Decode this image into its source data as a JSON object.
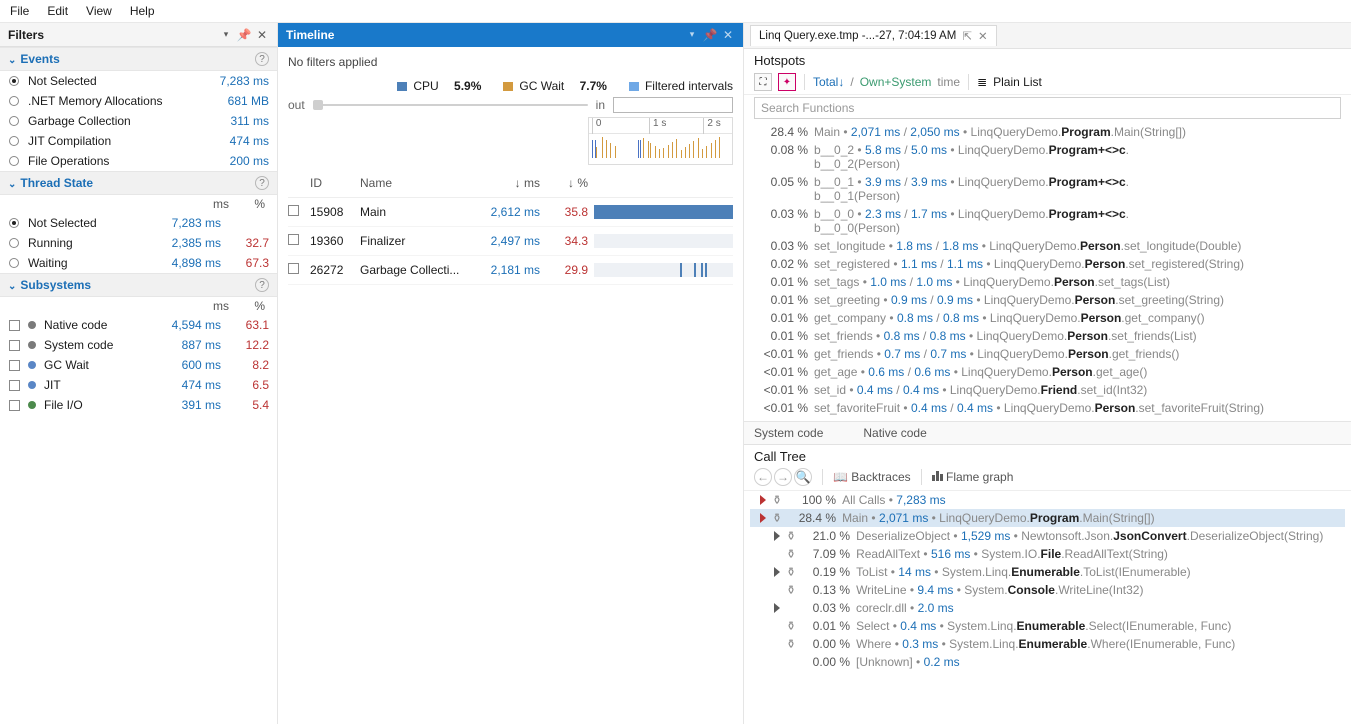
{
  "menu": {
    "file": "File",
    "edit": "Edit",
    "view": "View",
    "help": "Help"
  },
  "filters": {
    "title": "Filters",
    "events": {
      "title": "Events",
      "rows": [
        {
          "name": "Not Selected",
          "ms": "7,283 ms",
          "selected": true,
          "kind": "radio"
        },
        {
          "name": ".NET Memory Allocations",
          "ms": "681 MB",
          "selected": false,
          "kind": "radio"
        },
        {
          "name": "Garbage Collection",
          "ms": "311 ms",
          "selected": false,
          "kind": "radio"
        },
        {
          "name": "JIT Compilation",
          "ms": "474 ms",
          "selected": false,
          "kind": "radio"
        },
        {
          "name": "File Operations",
          "ms": "200 ms",
          "selected": false,
          "kind": "radio"
        }
      ]
    },
    "thread": {
      "title": "Thread State",
      "header": {
        "ms": "ms",
        "pct": "%"
      },
      "rows": [
        {
          "name": "Not Selected",
          "ms": "7,283 ms",
          "pct": "",
          "selected": true,
          "kind": "radio"
        },
        {
          "name": "Running",
          "ms": "2,385 ms",
          "pct": "32.7",
          "selected": false,
          "kind": "radio"
        },
        {
          "name": "Waiting",
          "ms": "4,898 ms",
          "pct": "67.3",
          "selected": false,
          "kind": "radio"
        }
      ]
    },
    "subsystems": {
      "title": "Subsystems",
      "header": {
        "ms": "ms",
        "pct": "%"
      },
      "rows": [
        {
          "name": "Native code",
          "ms": "4,594 ms",
          "pct": "63.1",
          "color": "#7a7a7a"
        },
        {
          "name": "System code",
          "ms": "887 ms",
          "pct": "12.2",
          "color": "#7a7a7a"
        },
        {
          "name": "GC Wait",
          "ms": "600 ms",
          "pct": "8.2",
          "color": "#5a86c5"
        },
        {
          "name": "JIT",
          "ms": "474 ms",
          "pct": "6.5",
          "color": "#5a86c5"
        },
        {
          "name": "File I/O",
          "ms": "391 ms",
          "pct": "5.4",
          "color": "#4c8a4c"
        }
      ]
    }
  },
  "timeline": {
    "title": "Timeline",
    "nofilters": "No filters applied",
    "legend": {
      "cpu": "CPU",
      "cpu_pct": "5.9%",
      "gc": "GC Wait",
      "gc_pct": "7.7%",
      "filtered": "Filtered intervals"
    },
    "zoom": {
      "out": "out",
      "in": "in"
    },
    "ruler": [
      "0",
      "1 s",
      "2 s"
    ],
    "columns": {
      "id": "ID",
      "name": "Name",
      "ms": "↓ ms",
      "pct": "↓ %"
    },
    "rows": [
      {
        "id": "15908",
        "name": "Main",
        "ms": "2,612 ms",
        "pct": "35.8",
        "main": true
      },
      {
        "id": "19360",
        "name": "Finalizer",
        "ms": "2,497 ms",
        "pct": "34.3"
      },
      {
        "id": "26272",
        "name": "Garbage Collecti...",
        "ms": "2,181 ms",
        "pct": "29.9",
        "marks": [
          62,
          72,
          77,
          80
        ]
      }
    ]
  },
  "tab": {
    "label": "Linq Query.exe.tmp -...-27, 7:04:19 AM"
  },
  "hotspots": {
    "title": "Hotspots",
    "toolbar": {
      "total": "Total↓",
      "sep": "/",
      "own": "Own+System",
      "time": "time",
      "plain": "Plain List"
    },
    "search_placeholder": "Search Functions",
    "rows": [
      {
        "pct": "28.4 %",
        "short": "Main",
        "t1": "2,071 ms",
        "t2": "2,050 ms",
        "pre": "LinqQueryDemo.",
        "strong": "Program",
        "post": ".Main(String[])"
      },
      {
        "pct": "0.08 %",
        "short": "<Main>b__0_2",
        "t1": "5.8 ms",
        "t2": "5.0 ms",
        "pre": "LinqQueryDemo.",
        "strong": "Program+<>c",
        "post": ".<Main>b__0_2(Person)"
      },
      {
        "pct": "0.05 %",
        "short": "<Main>b__0_1",
        "t1": "3.9 ms",
        "t2": "3.9 ms",
        "pre": "LinqQueryDemo.",
        "strong": "Program+<>c",
        "post": ".<Main>b__0_1(Person)"
      },
      {
        "pct": "0.03 %",
        "short": "<Main>b__0_0",
        "t1": "2.3 ms",
        "t2": "1.7 ms",
        "pre": "LinqQueryDemo.",
        "strong": "Program+<>c",
        "post": ".<Main>b__0_0(Person)"
      },
      {
        "pct": "0.03 %",
        "short": "set_longitude",
        "t1": "1.8 ms",
        "t2": "1.8 ms",
        "pre": "LinqQueryDemo.",
        "strong": "Person",
        "post": ".set_longitude(Double)"
      },
      {
        "pct": "0.02 %",
        "short": "set_registered",
        "t1": "1.1 ms",
        "t2": "1.1 ms",
        "pre": "LinqQueryDemo.",
        "strong": "Person",
        "post": ".set_registered(String)"
      },
      {
        "pct": "0.01 %",
        "short": "set_tags",
        "t1": "1.0 ms",
        "t2": "1.0 ms",
        "pre": "LinqQueryDemo.",
        "strong": "Person",
        "post": ".set_tags(List)"
      },
      {
        "pct": "0.01 %",
        "short": "set_greeting",
        "t1": "0.9 ms",
        "t2": "0.9 ms",
        "pre": "LinqQueryDemo.",
        "strong": "Person",
        "post": ".set_greeting(String)"
      },
      {
        "pct": "0.01 %",
        "short": "get_company",
        "t1": "0.8 ms",
        "t2": "0.8 ms",
        "pre": "LinqQueryDemo.",
        "strong": "Person",
        "post": ".get_company()"
      },
      {
        "pct": "0.01 %",
        "short": "set_friends",
        "t1": "0.8 ms",
        "t2": "0.8 ms",
        "pre": "LinqQueryDemo.",
        "strong": "Person",
        "post": ".set_friends(List)"
      },
      {
        "pct": "<0.01 %",
        "short": "get_friends",
        "t1": "0.7 ms",
        "t2": "0.7 ms",
        "pre": "LinqQueryDemo.",
        "strong": "Person",
        "post": ".get_friends()"
      },
      {
        "pct": "<0.01 %",
        "short": "get_age",
        "t1": "0.6 ms",
        "t2": "0.6 ms",
        "pre": "LinqQueryDemo.",
        "strong": "Person",
        "post": ".get_age()"
      },
      {
        "pct": "<0.01 %",
        "short": "set_id",
        "t1": "0.4 ms",
        "t2": "0.4 ms",
        "pre": "LinqQueryDemo.",
        "strong": "Friend",
        "post": ".set_id(Int32)"
      },
      {
        "pct": "<0.01 %",
        "short": "set_favoriteFruit",
        "t1": "0.4 ms",
        "t2": "0.4 ms",
        "pre": "LinqQueryDemo.",
        "strong": "Person",
        "post": ".set_favoriteFruit(String)"
      }
    ],
    "legend": {
      "system": "System code",
      "native": "Native code"
    }
  },
  "calltree": {
    "title": "Call Tree",
    "toolbar": {
      "backtraces": "Backtraces",
      "flame": "Flame graph"
    },
    "rows": [
      {
        "depth": 0,
        "arrow": "rightred",
        "filter": true,
        "pct": "100 %",
        "text": [
          {
            "g": "All Calls • "
          },
          {
            "b": "7,283 ms"
          }
        ]
      },
      {
        "depth": 0,
        "arrow": "rightred",
        "filter": true,
        "pct": "28.4 %",
        "sel": true,
        "text": [
          {
            "g": "Main • "
          },
          {
            "b": "2,071 ms"
          },
          {
            "g": " • LinqQueryDemo."
          },
          {
            "s": "Program"
          },
          {
            "g": ".Main(String[])"
          }
        ]
      },
      {
        "depth": 1,
        "arrow": "right",
        "filter": true,
        "pct": "21.0 %",
        "text": [
          {
            "g": "DeserializeObject • "
          },
          {
            "b": "1,529 ms"
          },
          {
            "g": " • Newtonsoft.Json."
          },
          {
            "s": "JsonConvert"
          },
          {
            "g": ".DeserializeObject(String)"
          }
        ]
      },
      {
        "depth": 1,
        "arrow": "",
        "filter": true,
        "pct": "7.09 %",
        "text": [
          {
            "g": "ReadAllText • "
          },
          {
            "b": "516 ms"
          },
          {
            "g": " • System.IO."
          },
          {
            "s": "File"
          },
          {
            "g": ".ReadAllText(String)"
          }
        ]
      },
      {
        "depth": 1,
        "arrow": "right",
        "filter": true,
        "pct": "0.19 %",
        "text": [
          {
            "g": "ToList • "
          },
          {
            "b": "14 ms"
          },
          {
            "g": " • System.Linq."
          },
          {
            "s": "Enumerable"
          },
          {
            "g": ".ToList(IEnumerable)"
          }
        ]
      },
      {
        "depth": 1,
        "arrow": "",
        "filter": true,
        "pct": "0.13 %",
        "text": [
          {
            "g": "WriteLine • "
          },
          {
            "b": "9.4 ms"
          },
          {
            "g": " • System."
          },
          {
            "s": "Console"
          },
          {
            "g": ".WriteLine(Int32)"
          }
        ]
      },
      {
        "depth": 1,
        "arrow": "right",
        "filter": false,
        "pct": "0.03 %",
        "text": [
          {
            "g": "coreclr.dll • "
          },
          {
            "b": "2.0 ms"
          }
        ]
      },
      {
        "depth": 1,
        "arrow": "",
        "filter": true,
        "pct": "0.01 %",
        "text": [
          {
            "g": "Select • "
          },
          {
            "b": "0.4 ms"
          },
          {
            "g": " • System.Linq."
          },
          {
            "s": "Enumerable"
          },
          {
            "g": ".Select(IEnumerable, Func)"
          }
        ]
      },
      {
        "depth": 1,
        "arrow": "",
        "filter": true,
        "pct": "0.00 %",
        "text": [
          {
            "g": "Where • "
          },
          {
            "b": "0.3 ms"
          },
          {
            "g": " • System.Linq."
          },
          {
            "s": "Enumerable"
          },
          {
            "g": ".Where(IEnumerable, Func)"
          }
        ]
      },
      {
        "depth": 1,
        "arrow": "",
        "filter": false,
        "pct": "0.00 %",
        "text": [
          {
            "g": "[Unknown] • "
          },
          {
            "b": "0.2 ms"
          }
        ]
      }
    ]
  }
}
